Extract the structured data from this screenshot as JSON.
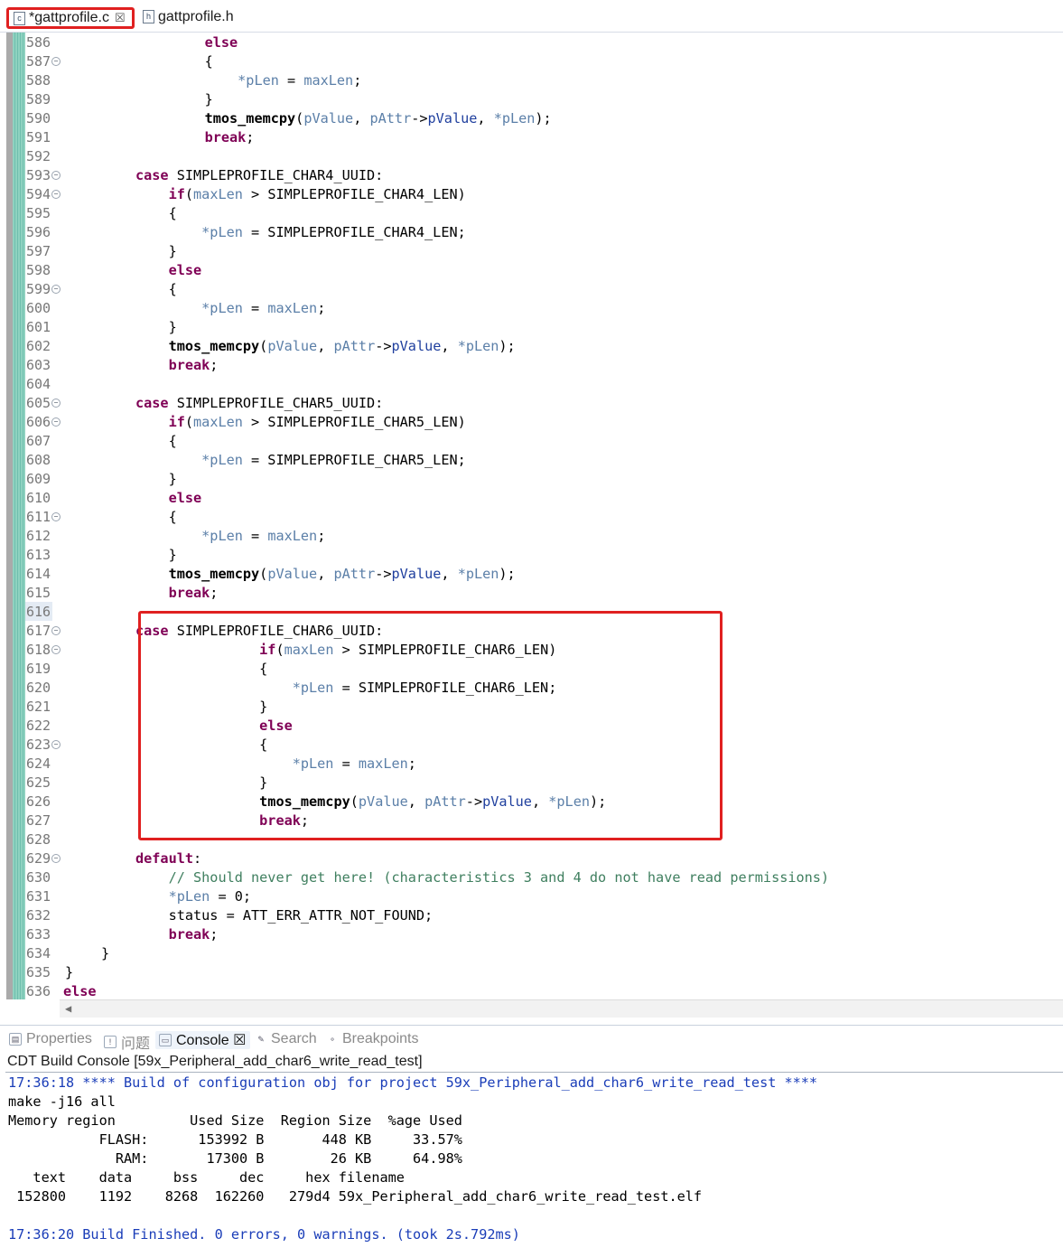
{
  "editor_tabs": [
    {
      "label": "*gattprofile.c",
      "icon": "c-source-file-icon"
    },
    {
      "label": "gattprofile.h",
      "icon": "h-header-file-icon"
    }
  ],
  "code_lines": [
    {
      "n": "586",
      "fold": false,
      "seg": [
        [
          "    ",
          "p"
        ],
        [
          "else",
          "kw"
        ]
      ]
    },
    {
      "n": "587",
      "fold": true,
      "seg": [
        [
          "    {",
          "p"
        ]
      ]
    },
    {
      "n": "588",
      "fold": false,
      "seg": [
        [
          "        ",
          "p"
        ],
        [
          "*pLen",
          "var"
        ],
        [
          " = ",
          "p"
        ],
        [
          "maxLen",
          "var"
        ],
        [
          ";",
          "p"
        ]
      ]
    },
    {
      "n": "589",
      "fold": false,
      "seg": [
        [
          "    }",
          "p"
        ]
      ]
    },
    {
      "n": "590",
      "fold": false,
      "seg": [
        [
          "    ",
          "p"
        ],
        [
          "tmos_memcpy",
          "fn"
        ],
        [
          "(",
          "p"
        ],
        [
          "pValue",
          "var"
        ],
        [
          ", ",
          "p"
        ],
        [
          "pAttr",
          "var"
        ],
        [
          "->",
          "p"
        ],
        [
          "pValue",
          "mem"
        ],
        [
          ", ",
          "p"
        ],
        [
          "*pLen",
          "var"
        ],
        [
          ");",
          "p"
        ]
      ]
    },
    {
      "n": "591",
      "fold": false,
      "seg": [
        [
          "    ",
          "p"
        ],
        [
          "break",
          "kw"
        ],
        [
          ";",
          "p"
        ]
      ]
    },
    {
      "n": "592",
      "fold": false,
      "seg": []
    },
    {
      "n": "593",
      "fold": true,
      "seg": [
        [
          "case",
          "kw"
        ],
        [
          " SIMPLEPROFILE_CHAR4_UUID:",
          "p"
        ]
      ]
    },
    {
      "n": "594",
      "fold": true,
      "seg": [
        [
          "    ",
          "p"
        ],
        [
          "if",
          "kw"
        ],
        [
          "(",
          "p"
        ],
        [
          "maxLen",
          "var"
        ],
        [
          " > SIMPLEPROFILE_CHAR4_LEN)",
          "p"
        ]
      ]
    },
    {
      "n": "595",
      "fold": false,
      "seg": [
        [
          "    {",
          "p"
        ]
      ]
    },
    {
      "n": "596",
      "fold": false,
      "seg": [
        [
          "        ",
          "p"
        ],
        [
          "*pLen",
          "var"
        ],
        [
          " = SIMPLEPROFILE_CHAR4_LEN;",
          "p"
        ]
      ]
    },
    {
      "n": "597",
      "fold": false,
      "seg": [
        [
          "    }",
          "p"
        ]
      ]
    },
    {
      "n": "598",
      "fold": false,
      "seg": [
        [
          "    ",
          "p"
        ],
        [
          "else",
          "kw"
        ]
      ]
    },
    {
      "n": "599",
      "fold": true,
      "seg": [
        [
          "    {",
          "p"
        ]
      ]
    },
    {
      "n": "600",
      "fold": false,
      "seg": [
        [
          "        ",
          "p"
        ],
        [
          "*pLen",
          "var"
        ],
        [
          " = ",
          "p"
        ],
        [
          "maxLen",
          "var"
        ],
        [
          ";",
          "p"
        ]
      ]
    },
    {
      "n": "601",
      "fold": false,
      "seg": [
        [
          "    }",
          "p"
        ]
      ]
    },
    {
      "n": "602",
      "fold": false,
      "seg": [
        [
          "    ",
          "p"
        ],
        [
          "tmos_memcpy",
          "fn"
        ],
        [
          "(",
          "p"
        ],
        [
          "pValue",
          "var"
        ],
        [
          ", ",
          "p"
        ],
        [
          "pAttr",
          "var"
        ],
        [
          "->",
          "p"
        ],
        [
          "pValue",
          "mem"
        ],
        [
          ", ",
          "p"
        ],
        [
          "*pLen",
          "var"
        ],
        [
          ");",
          "p"
        ]
      ]
    },
    {
      "n": "603",
      "fold": false,
      "seg": [
        [
          "    ",
          "p"
        ],
        [
          "break",
          "kw"
        ],
        [
          ";",
          "p"
        ]
      ]
    },
    {
      "n": "604",
      "fold": false,
      "seg": []
    },
    {
      "n": "605",
      "fold": true,
      "seg": [
        [
          "case",
          "kw"
        ],
        [
          " SIMPLEPROFILE_CHAR5_UUID:",
          "p"
        ]
      ]
    },
    {
      "n": "606",
      "fold": true,
      "seg": [
        [
          "    ",
          "p"
        ],
        [
          "if",
          "kw"
        ],
        [
          "(",
          "p"
        ],
        [
          "maxLen",
          "var"
        ],
        [
          " > SIMPLEPROFILE_CHAR5_LEN)",
          "p"
        ]
      ]
    },
    {
      "n": "607",
      "fold": false,
      "seg": [
        [
          "    {",
          "p"
        ]
      ]
    },
    {
      "n": "608",
      "fold": false,
      "seg": [
        [
          "        ",
          "p"
        ],
        [
          "*pLen",
          "var"
        ],
        [
          " = SIMPLEPROFILE_CHAR5_LEN;",
          "p"
        ]
      ]
    },
    {
      "n": "609",
      "fold": false,
      "seg": [
        [
          "    }",
          "p"
        ]
      ]
    },
    {
      "n": "610",
      "fold": false,
      "seg": [
        [
          "    ",
          "p"
        ],
        [
          "else",
          "kw"
        ]
      ]
    },
    {
      "n": "611",
      "fold": true,
      "seg": [
        [
          "    {",
          "p"
        ]
      ]
    },
    {
      "n": "612",
      "fold": false,
      "seg": [
        [
          "        ",
          "p"
        ],
        [
          "*pLen",
          "var"
        ],
        [
          " = ",
          "p"
        ],
        [
          "maxLen",
          "var"
        ],
        [
          ";",
          "p"
        ]
      ]
    },
    {
      "n": "613",
      "fold": false,
      "seg": [
        [
          "    }",
          "p"
        ]
      ]
    },
    {
      "n": "614",
      "fold": false,
      "seg": [
        [
          "    ",
          "p"
        ],
        [
          "tmos_memcpy",
          "fn"
        ],
        [
          "(",
          "p"
        ],
        [
          "pValue",
          "var"
        ],
        [
          ", ",
          "p"
        ],
        [
          "pAttr",
          "var"
        ],
        [
          "->",
          "p"
        ],
        [
          "pValue",
          "mem"
        ],
        [
          ", ",
          "p"
        ],
        [
          "*pLen",
          "var"
        ],
        [
          ");",
          "p"
        ]
      ]
    },
    {
      "n": "615",
      "fold": false,
      "seg": [
        [
          "    ",
          "p"
        ],
        [
          "break",
          "kw"
        ],
        [
          ";",
          "p"
        ]
      ]
    },
    {
      "n": "616",
      "fold": false,
      "seg": []
    },
    {
      "n": "617",
      "fold": true,
      "seg": [
        [
          "case",
          "kw"
        ],
        [
          " SIMPLEPROFILE_CHAR6_UUID:",
          "p"
        ]
      ]
    },
    {
      "n": "618",
      "fold": true,
      "seg": [
        [
          "               ",
          "p"
        ],
        [
          "if",
          "kw"
        ],
        [
          "(",
          "p"
        ],
        [
          "maxLen",
          "var"
        ],
        [
          " > SIMPLEPROFILE_CHAR6_LEN)",
          "p"
        ]
      ]
    },
    {
      "n": "619",
      "fold": false,
      "seg": [
        [
          "               {",
          "p"
        ]
      ]
    },
    {
      "n": "620",
      "fold": false,
      "seg": [
        [
          "                   ",
          "p"
        ],
        [
          "*pLen",
          "var"
        ],
        [
          " = SIMPLEPROFILE_CHAR6_LEN;",
          "p"
        ]
      ]
    },
    {
      "n": "621",
      "fold": false,
      "seg": [
        [
          "               }",
          "p"
        ]
      ]
    },
    {
      "n": "622",
      "fold": false,
      "seg": [
        [
          "               ",
          "p"
        ],
        [
          "else",
          "kw"
        ]
      ]
    },
    {
      "n": "623",
      "fold": true,
      "seg": [
        [
          "               {",
          "p"
        ]
      ]
    },
    {
      "n": "624",
      "fold": false,
      "seg": [
        [
          "                   ",
          "p"
        ],
        [
          "*pLen",
          "var"
        ],
        [
          " = ",
          "p"
        ],
        [
          "maxLen",
          "var"
        ],
        [
          ";",
          "p"
        ]
      ]
    },
    {
      "n": "625",
      "fold": false,
      "seg": [
        [
          "               }",
          "p"
        ]
      ]
    },
    {
      "n": "626",
      "fold": false,
      "seg": [
        [
          "               ",
          "p"
        ],
        [
          "tmos_memcpy",
          "fn"
        ],
        [
          "(",
          "p"
        ],
        [
          "pValue",
          "var"
        ],
        [
          ", ",
          "p"
        ],
        [
          "pAttr",
          "var"
        ],
        [
          "->",
          "p"
        ],
        [
          "pValue",
          "mem"
        ],
        [
          ", ",
          "p"
        ],
        [
          "*pLen",
          "var"
        ],
        [
          ");",
          "p"
        ]
      ]
    },
    {
      "n": "627",
      "fold": false,
      "seg": [
        [
          "               ",
          "p"
        ],
        [
          "break",
          "kw"
        ],
        [
          ";",
          "p"
        ]
      ]
    },
    {
      "n": "628",
      "fold": false,
      "seg": []
    },
    {
      "n": "629",
      "fold": true,
      "seg": [
        [
          "default",
          "kw"
        ],
        [
          ":",
          "p"
        ]
      ]
    },
    {
      "n": "630",
      "fold": false,
      "seg": [
        [
          "    ",
          "p"
        ],
        [
          "// Should never get here! (characteristics 3 and 4 do not have read permissions)",
          "cm"
        ]
      ]
    },
    {
      "n": "631",
      "fold": false,
      "seg": [
        [
          "    ",
          "p"
        ],
        [
          "*pLen",
          "var"
        ],
        [
          " = 0;",
          "p"
        ]
      ]
    },
    {
      "n": "632",
      "fold": false,
      "seg": [
        [
          "    status = ATT_ERR_ATTR_NOT_FOUND;",
          "p"
        ]
      ]
    },
    {
      "n": "633",
      "fold": false,
      "seg": [
        [
          "    ",
          "p"
        ],
        [
          "break",
          "kw"
        ],
        [
          ";",
          "p"
        ]
      ]
    },
    {
      "n": "634",
      "fold": false,
      "seg": [
        [
          "}",
          "p"
        ]
      ]
    },
    {
      "n": "635",
      "fold": false,
      "seg": [
        [
          "}",
          "p"
        ]
      ]
    },
    {
      "n": "636",
      "fold": false,
      "seg": [
        [
          "else",
          "kw"
        ]
      ]
    }
  ],
  "views": {
    "tabs": [
      {
        "label": "Properties",
        "icon": "properties-icon"
      },
      {
        "label": "问题",
        "icon": "problems-icon"
      },
      {
        "label": "Console ☒",
        "icon": "console-icon"
      },
      {
        "label": "Search",
        "icon": "search-icon"
      },
      {
        "label": "Breakpoints",
        "icon": "breakpoints-icon"
      }
    ],
    "console_title": "CDT Build Console [59x_Peripheral_add_char6_write_read_test]",
    "console_lines": [
      {
        "text": "17:36:18 **** Build of configuration obj for project 59x_Peripheral_add_char6_write_read_test ****",
        "style": "blue"
      },
      {
        "text": "make -j16 all",
        "style": "plain"
      },
      {
        "text": "Memory region         Used Size  Region Size  %age Used",
        "style": "plain"
      },
      {
        "text": "           FLASH:      153992 B       448 KB     33.57%",
        "style": "plain"
      },
      {
        "text": "             RAM:       17300 B        26 KB     64.98%",
        "style": "plain"
      },
      {
        "text": "   text    data     bss     dec     hex filename",
        "style": "plain"
      },
      {
        "text": " 152800    1192    8268  162260   279d4 59x_Peripheral_add_char6_write_read_test.elf",
        "style": "plain"
      },
      {
        "text": "",
        "style": "plain"
      },
      {
        "text": "17:36:20 Build Finished. 0 errors, 0 warnings. (took 2s.792ms)",
        "style": "blue"
      }
    ]
  },
  "colors": {
    "keyword": "#7f0055",
    "variable": "#5b7fa8",
    "comment": "#3f7f5f",
    "highlight_border": "#e02020"
  }
}
